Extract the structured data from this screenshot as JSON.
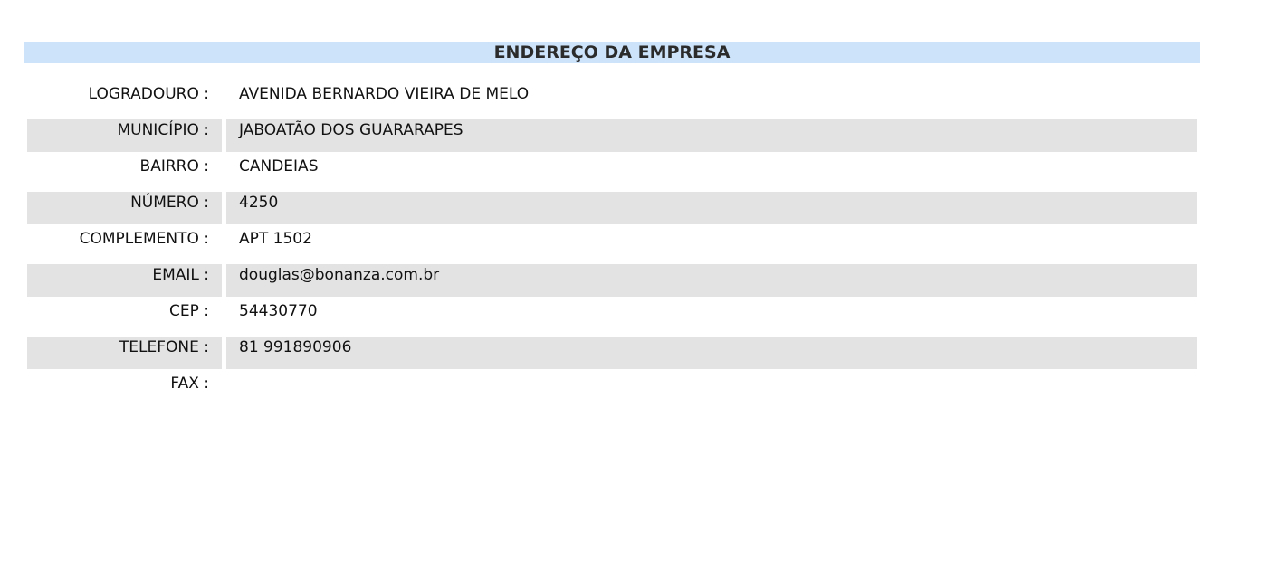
{
  "section": {
    "title": "ENDEREÇO DA EMPRESA"
  },
  "fields": [
    {
      "label": "LOGRADOURO :",
      "value": "AVENIDA BERNARDO VIEIRA DE MELO"
    },
    {
      "label": "MUNICÍPIO :",
      "value": "JABOATÃO DOS GUARARAPES"
    },
    {
      "label": "BAIRRO :",
      "value": "CANDEIAS"
    },
    {
      "label": "NÚMERO :",
      "value": "4250"
    },
    {
      "label": "COMPLEMENTO :",
      "value": "APT 1502"
    },
    {
      "label": "EMAIL :",
      "value": "douglas@bonanza.com.br"
    },
    {
      "label": "CEP :",
      "value": "54430770"
    },
    {
      "label": "TELEFONE :",
      "value": "81 991890906"
    },
    {
      "label": "FAX :",
      "value": ""
    }
  ],
  "colors": {
    "header_bg": "#cce3fa",
    "alt_row_bg": "#e3e3e3"
  }
}
